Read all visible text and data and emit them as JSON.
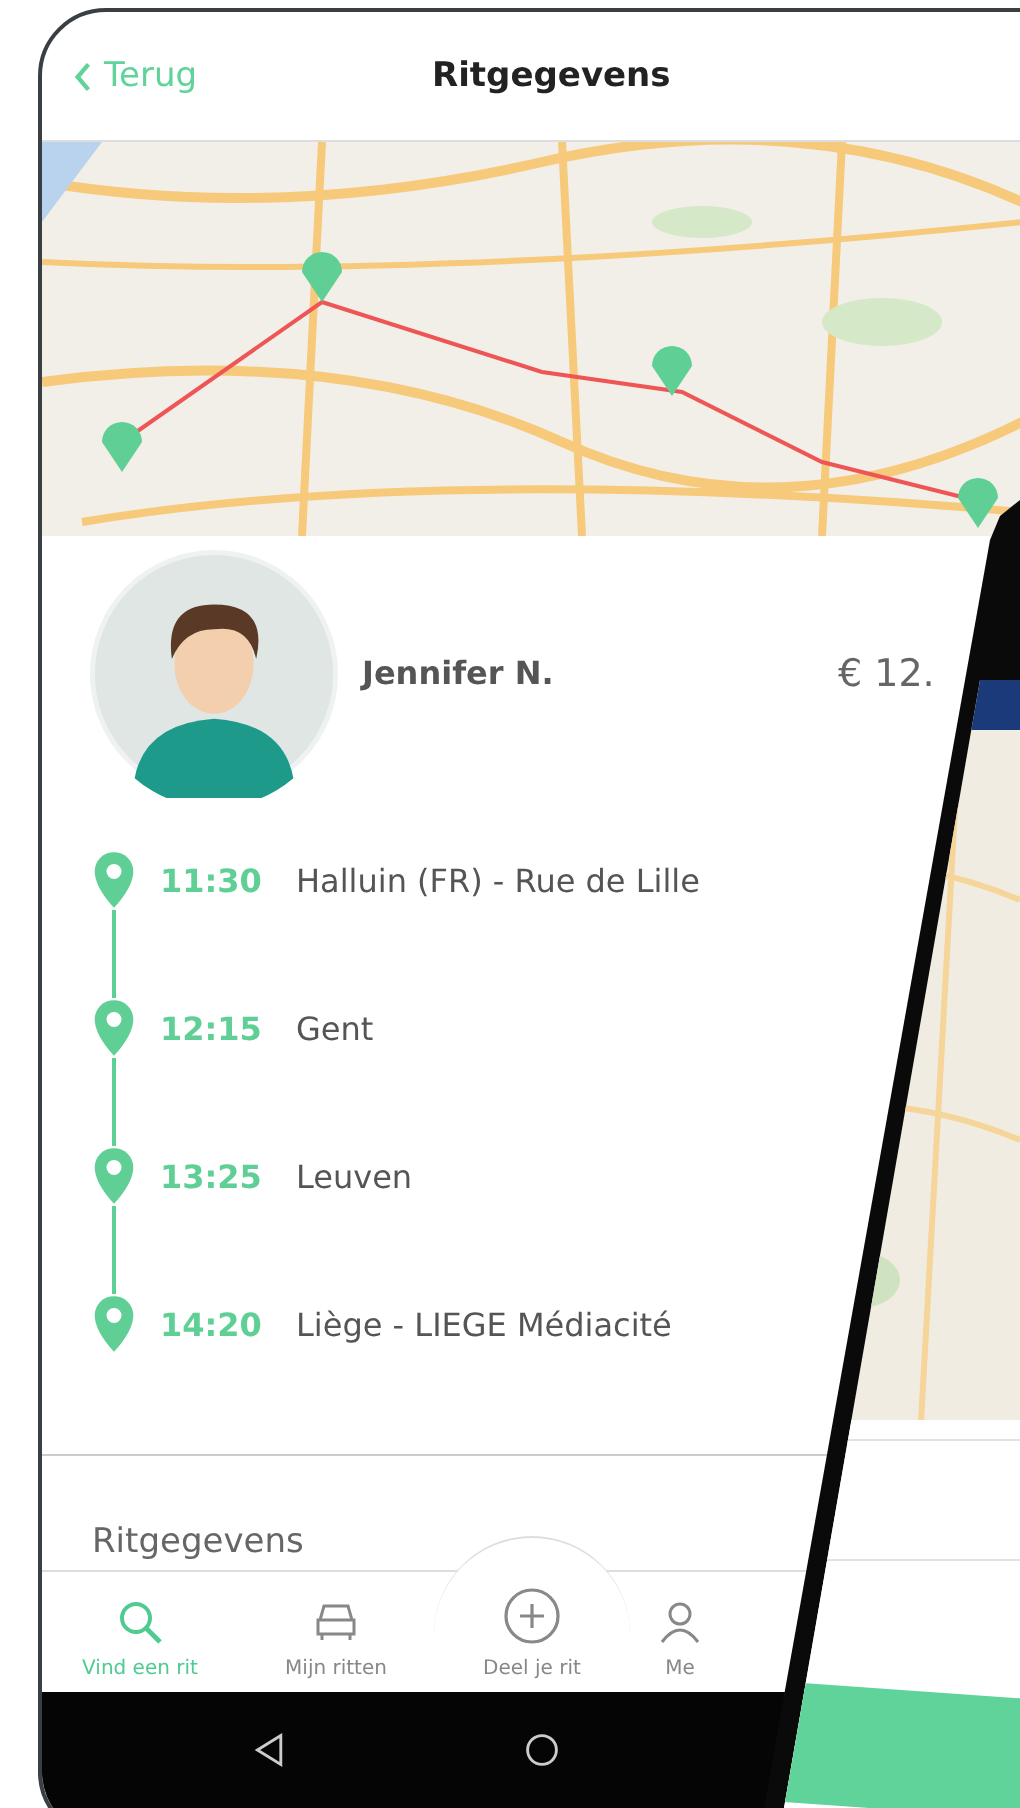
{
  "header": {
    "back": "Terug",
    "title": "Ritgegevens"
  },
  "driver": {
    "name": "Jennifer N.",
    "price": "€ 12."
  },
  "stops": [
    {
      "time": "11:30",
      "place": "Halluin (FR) - Rue de Lille"
    },
    {
      "time": "12:15",
      "place": "Gent"
    },
    {
      "time": "13:25",
      "place": "Leuven"
    },
    {
      "time": "14:20",
      "place": "Liège - LIEGE Médiacité"
    }
  ],
  "section_title": "Ritgegevens",
  "nav": [
    {
      "kind": "search",
      "label": "Vind een rit",
      "selected": true
    },
    {
      "kind": "car",
      "label": "Mijn ritten",
      "selected": false
    },
    {
      "kind": "plus",
      "label": "Deel je rit",
      "selected": false
    },
    {
      "kind": "person",
      "label": "Me",
      "selected": false
    }
  ]
}
